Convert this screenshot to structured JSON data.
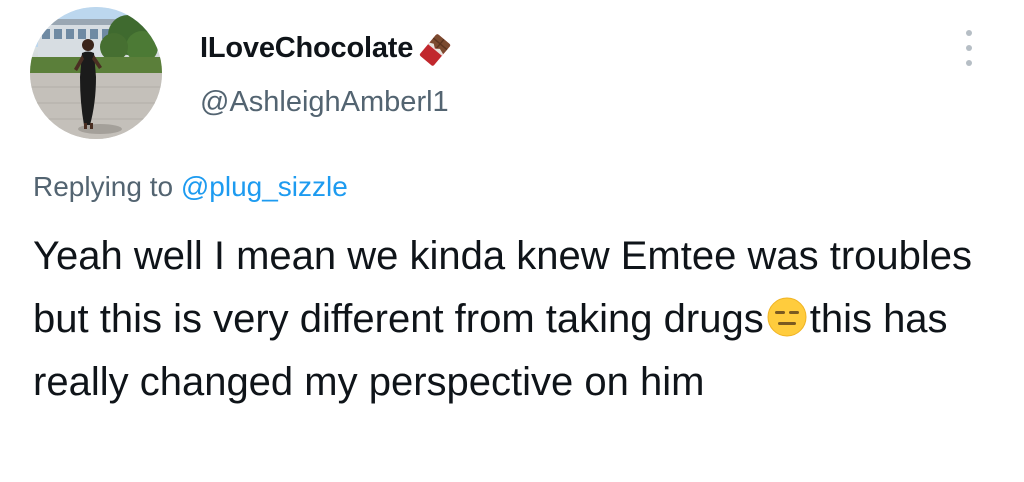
{
  "user": {
    "display_name": "ILoveChocolate",
    "handle": "@AshleighAmberl1",
    "name_emoji": "chocolate-bar-icon",
    "avatar": "profile-photo"
  },
  "reply": {
    "prefix": "Replying to ",
    "mention": "@plug_sizzle"
  },
  "tweet": {
    "text_part1": "Yeah well I mean we kinda knew Emtee was troubles but this is very different from taking drugs",
    "emoji": "expressionless-face-icon",
    "text_part2": "this has really changed my perspective on him"
  },
  "colors": {
    "text": "#0f1419",
    "secondary": "#536471",
    "link": "#1d9bf0"
  }
}
